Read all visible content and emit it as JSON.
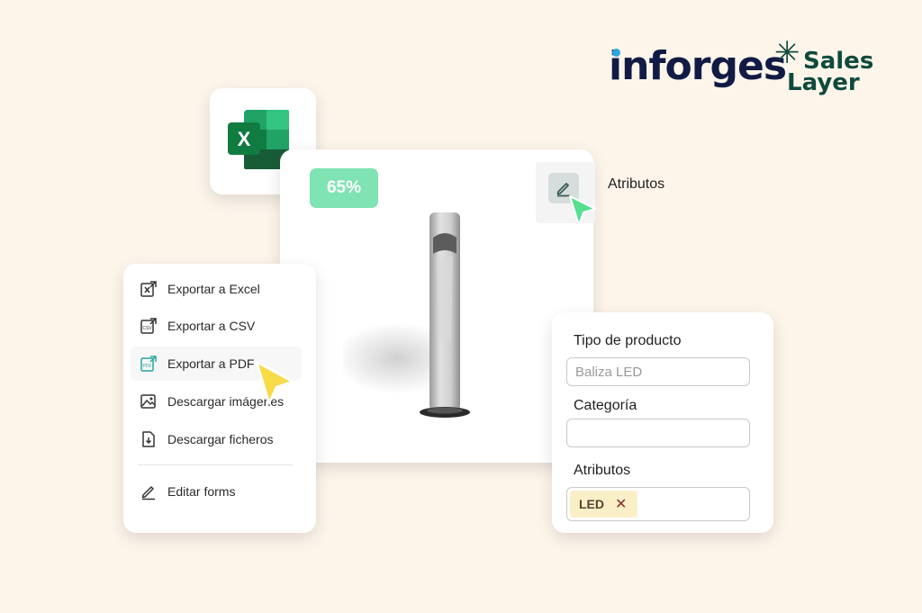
{
  "brands": {
    "inforges": "inforges",
    "saleslayer_line1": "Sales",
    "saleslayer_line2": "Layer"
  },
  "excel_tile": {
    "icon": "excel-icon",
    "letter": "X"
  },
  "product_card": {
    "completion_badge": "65%",
    "edit_icon": "pencil-icon",
    "edit_tooltip": "Atributos"
  },
  "menu": {
    "items": [
      {
        "label": "Exportar a Excel",
        "icon": "export-excel-icon"
      },
      {
        "label": "Exportar a CSV",
        "icon": "export-csv-icon"
      },
      {
        "label": "Exportar a PDF",
        "icon": "export-pdf-icon",
        "active": true
      },
      {
        "label": "Descargar imágenes",
        "icon": "download-images-icon"
      },
      {
        "label": "Descargar ficheros",
        "icon": "download-files-icon"
      },
      {
        "label": "Editar forms",
        "icon": "pencil-icon"
      }
    ]
  },
  "form": {
    "product_type_label": "Tipo de producto",
    "product_type_placeholder": "Baliza LED",
    "category_label": "Categoría",
    "category_value": "",
    "attributes_label": "Atributos",
    "attribute_tags": [
      "LED"
    ]
  },
  "colors": {
    "background": "#fdf5ea",
    "badge_green": "#7fe3b3",
    "cursor_green": "#55e08f",
    "cursor_yellow": "#f7dc4a",
    "tag_bg": "#faf0c8",
    "brand_navy": "#111b45",
    "brand_teal": "#0f4a3c"
  }
}
